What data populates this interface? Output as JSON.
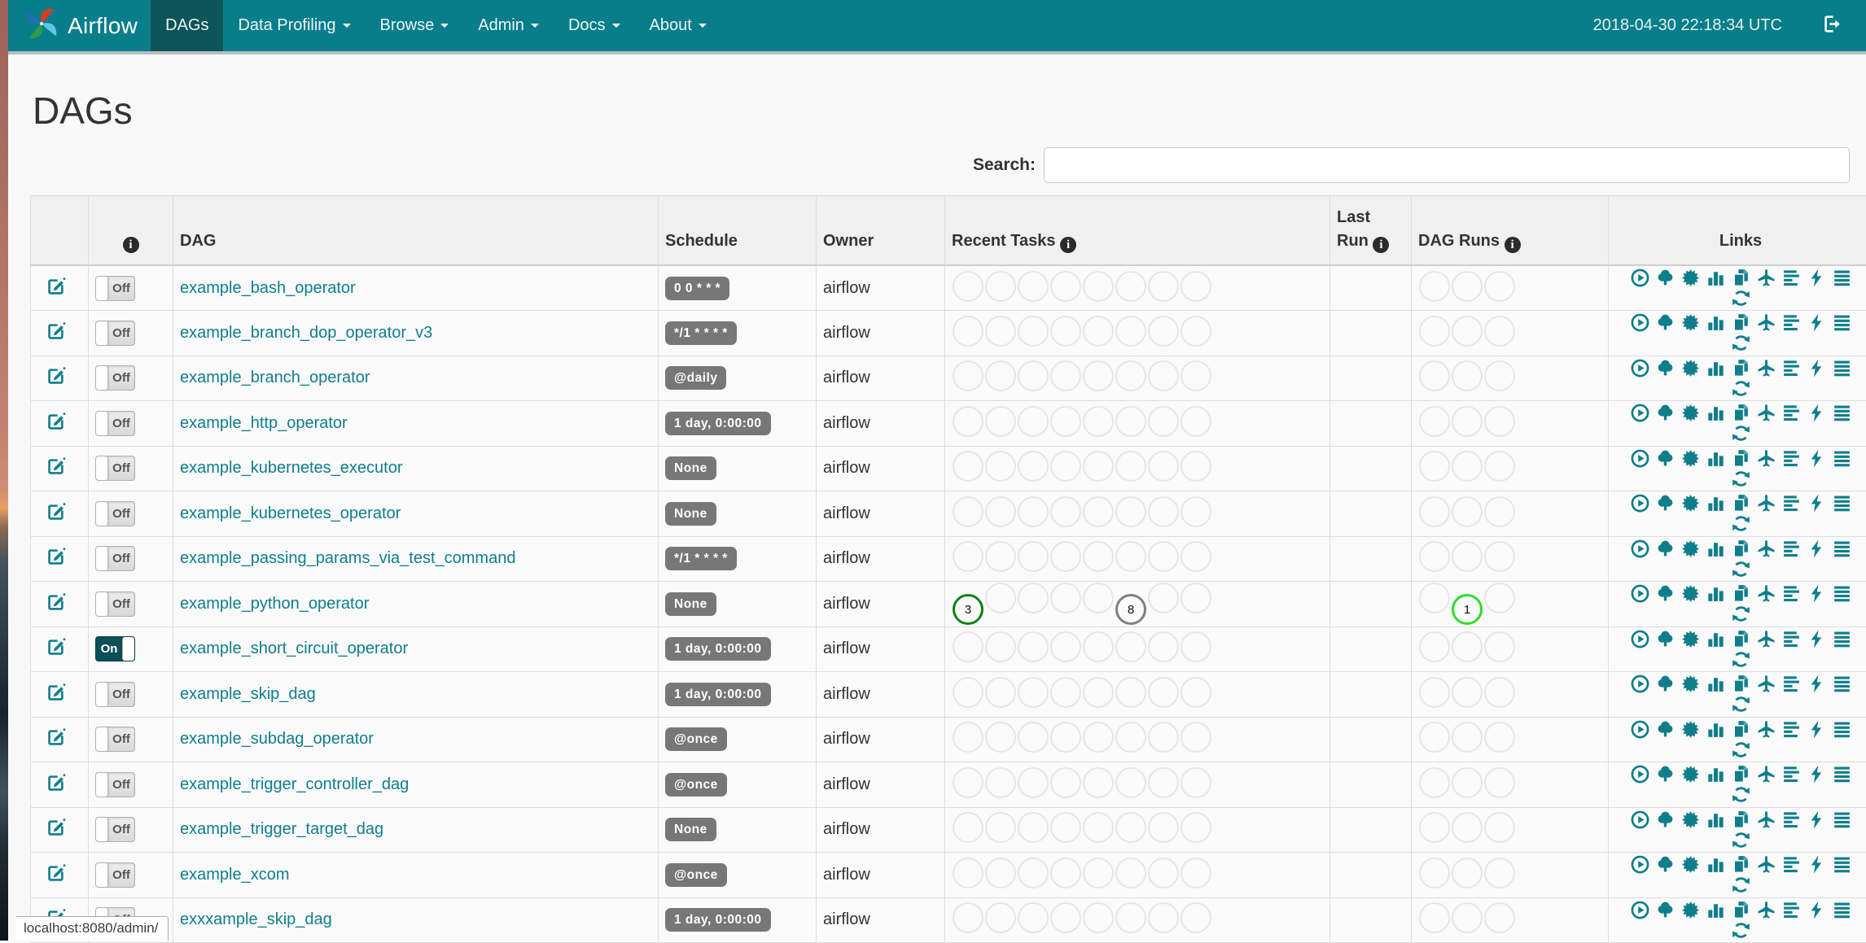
{
  "navbar": {
    "brand": "Airflow",
    "items": [
      {
        "label": "DAGs",
        "active": true,
        "caret": false
      },
      {
        "label": "Data Profiling",
        "active": false,
        "caret": true
      },
      {
        "label": "Browse",
        "active": false,
        "caret": true
      },
      {
        "label": "Admin",
        "active": false,
        "caret": true
      },
      {
        "label": "Docs",
        "active": false,
        "caret": true
      },
      {
        "label": "About",
        "active": false,
        "caret": true
      }
    ],
    "clock": "2018-04-30 22:18:34 UTC",
    "logout_icon": "log-out-icon"
  },
  "page": {
    "title": "DAGs",
    "search_label": "Search:",
    "search_value": ""
  },
  "table": {
    "headers": {
      "edit": "",
      "info_icon": "info-icon",
      "dag": "DAG",
      "schedule": "Schedule",
      "owner": "Owner",
      "recent_tasks": "Recent Tasks",
      "last_run": "Last Run",
      "dag_runs": "DAG Runs",
      "links": "Links"
    },
    "recent_task_slots": 8,
    "dag_run_slots": 3,
    "state_colors": {
      "success": "#108010",
      "queued": "#808080",
      "running": "#2adf28",
      "empty": "#e6e6e6"
    },
    "links_icons": [
      "trigger-dag-icon",
      "tree-view-icon",
      "graph-view-icon",
      "task-duration-icon",
      "task-tries-icon",
      "landing-times-icon",
      "gantt-view-icon",
      "code-view-icon",
      "logs-icon",
      "refresh-dag-icon"
    ],
    "rows": [
      {
        "name": "example_bash_operator",
        "toggle": "Off",
        "schedule": "0 0 * * *",
        "owner": "airflow",
        "recent_tasks": {},
        "dag_runs": {}
      },
      {
        "name": "example_branch_dop_operator_v3",
        "toggle": "Off",
        "schedule": "*/1 * * * *",
        "owner": "airflow",
        "recent_tasks": {},
        "dag_runs": {}
      },
      {
        "name": "example_branch_operator",
        "toggle": "Off",
        "schedule": "@daily",
        "owner": "airflow",
        "recent_tasks": {},
        "dag_runs": {}
      },
      {
        "name": "example_http_operator",
        "toggle": "Off",
        "schedule": "1 day, 0:00:00",
        "owner": "airflow",
        "recent_tasks": {},
        "dag_runs": {}
      },
      {
        "name": "example_kubernetes_executor",
        "toggle": "Off",
        "schedule": "None",
        "owner": "airflow",
        "recent_tasks": {},
        "dag_runs": {}
      },
      {
        "name": "example_kubernetes_operator",
        "toggle": "Off",
        "schedule": "None",
        "owner": "airflow",
        "recent_tasks": {},
        "dag_runs": {}
      },
      {
        "name": "example_passing_params_via_test_command",
        "toggle": "Off",
        "schedule": "*/1 * * * *",
        "owner": "airflow",
        "recent_tasks": {},
        "dag_runs": {}
      },
      {
        "name": "example_python_operator",
        "toggle": "Off",
        "schedule": "None",
        "owner": "airflow",
        "recent_tasks": {
          "0": {
            "count": "3",
            "state": "success"
          },
          "5": {
            "count": "8",
            "state": "queued"
          }
        },
        "dag_runs": {
          "1": {
            "count": "1",
            "state": "running"
          }
        }
      },
      {
        "name": "example_short_circuit_operator",
        "toggle": "On",
        "schedule": "1 day, 0:00:00",
        "owner": "airflow",
        "recent_tasks": {},
        "dag_runs": {}
      },
      {
        "name": "example_skip_dag",
        "toggle": "Off",
        "schedule": "1 day, 0:00:00",
        "owner": "airflow",
        "recent_tasks": {},
        "dag_runs": {}
      },
      {
        "name": "example_subdag_operator",
        "toggle": "Off",
        "schedule": "@once",
        "owner": "airflow",
        "recent_tasks": {},
        "dag_runs": {}
      },
      {
        "name": "example_trigger_controller_dag",
        "toggle": "Off",
        "schedule": "@once",
        "owner": "airflow",
        "recent_tasks": {},
        "dag_runs": {}
      },
      {
        "name": "example_trigger_target_dag",
        "toggle": "Off",
        "schedule": "None",
        "owner": "airflow",
        "recent_tasks": {},
        "dag_runs": {}
      },
      {
        "name": "example_xcom",
        "toggle": "Off",
        "schedule": "@once",
        "owner": "airflow",
        "recent_tasks": {},
        "dag_runs": {}
      },
      {
        "name": "exxxample_skip_dag",
        "toggle": "Off",
        "schedule": "1 day, 0:00:00",
        "owner": "airflow",
        "recent_tasks": {},
        "dag_runs": {}
      }
    ]
  },
  "status_bar": "localhost:8080/admin/",
  "colors": {
    "navbar_bg": "#077e8a",
    "navbar_active_bg": "#0d545b",
    "link_teal": "#0f7e8b",
    "badge_bg": "#777777",
    "toggle_on_bg": "#0b4f57"
  }
}
